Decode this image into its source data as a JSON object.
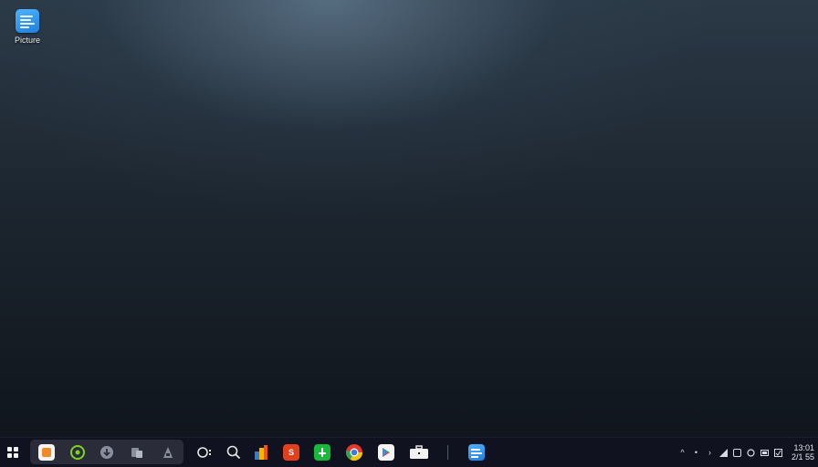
{
  "desktop": {
    "icon_label": "Picture"
  },
  "taskbar": {
    "clock_time": "13:01",
    "clock_date": "2/1 55",
    "apps": [
      "start-menu",
      "file-explorer",
      "edge-browser",
      "download-manager",
      "photos",
      "paint",
      "chat",
      "search",
      "ms-office",
      "office-app",
      "green-app",
      "chrome",
      "play-store",
      "briefcase",
      "picture-viewer"
    ]
  },
  "colors": {
    "taskbar_bg": "#11121f",
    "pinned_group_bg": "#2a2c3a",
    "accent_blue": "#1f7fdb"
  }
}
